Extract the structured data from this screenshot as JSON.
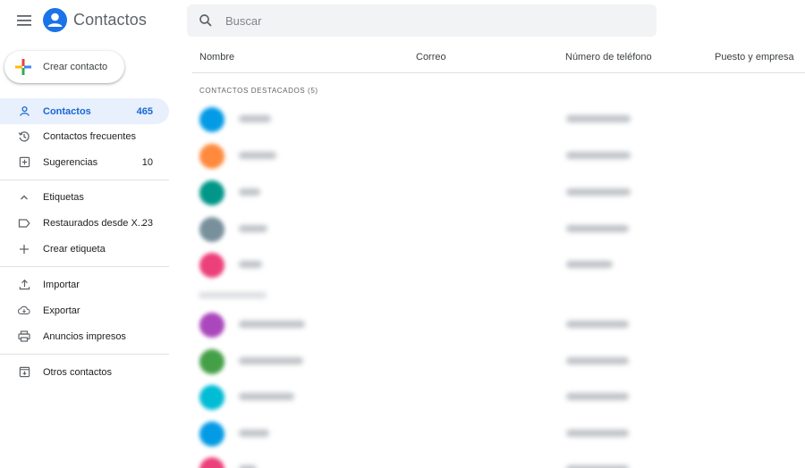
{
  "header": {
    "app_title": "Contactos",
    "search_placeholder": "Buscar"
  },
  "sidebar": {
    "create_label": "Crear contacto",
    "items": [
      {
        "label": "Contactos",
        "count": "465",
        "icon": "person-icon",
        "active": true
      },
      {
        "label": "Contactos frecuentes",
        "count": "",
        "icon": "history-icon",
        "active": false
      },
      {
        "label": "Sugerencias",
        "count": "10",
        "icon": "suggestion-icon",
        "active": false
      },
      {
        "label": "Etiquetas",
        "count": "",
        "icon": "chevron-up-icon",
        "active": false
      },
      {
        "label": "Restaurados desde X...",
        "count": "23",
        "icon": "label-icon",
        "active": false
      },
      {
        "label": "Crear etiqueta",
        "count": "",
        "icon": "plus-icon",
        "active": false
      },
      {
        "label": "Importar",
        "count": "",
        "icon": "upload-icon",
        "active": false
      },
      {
        "label": "Exportar",
        "count": "",
        "icon": "cloud-download-icon",
        "active": false
      },
      {
        "label": "Anuncios impresos",
        "count": "",
        "icon": "print-icon",
        "active": false
      },
      {
        "label": "Otros contactos",
        "count": "",
        "icon": "archive-icon",
        "active": false
      }
    ]
  },
  "table": {
    "columns": [
      "Nombre",
      "Correo",
      "Número de teléfono",
      "Puesto y empresa"
    ],
    "section_label": "CONTACTOS DESTACADOS (5)"
  },
  "colors": {
    "accent": "#1a73e8",
    "active_bg": "#e8f0fe",
    "active_text": "#1967d2"
  },
  "contact_avatar_colors": [
    "#039be5",
    "#ff8a3d",
    "#009688",
    "#78909c",
    "#ec407a",
    "#ab47bc",
    "#43a047",
    "#00bcd4",
    "#039be5",
    "#ec407a"
  ]
}
